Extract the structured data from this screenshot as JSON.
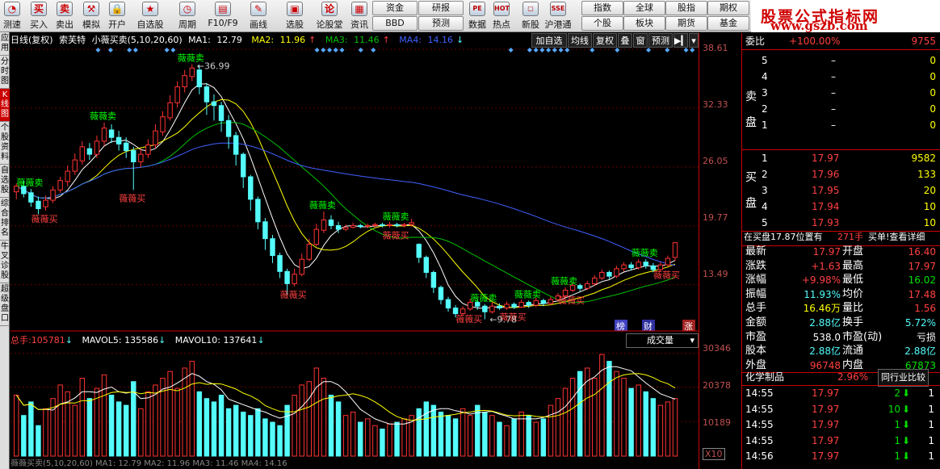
{
  "toolbar": {
    "buttons": [
      {
        "label": "测速",
        "icon": "speed-icon"
      },
      {
        "label": "买入",
        "icon": "buy-icon",
        "glyph": "买"
      },
      {
        "label": "卖出",
        "icon": "sell-icon",
        "glyph": "卖"
      },
      {
        "label": "模拟",
        "icon": "simulate-icon",
        "glyph": "⚒"
      },
      {
        "label": "开户",
        "icon": "open-account-icon",
        "glyph": "🔒"
      },
      {
        "label": "自选股",
        "icon": "watchlist-icon",
        "glyph": "★"
      },
      {
        "label": "周期",
        "icon": "period-icon",
        "glyph": "◷"
      },
      {
        "label": "F10/F9",
        "icon": "f10-icon",
        "glyph": "▤"
      },
      {
        "label": "画线",
        "icon": "draw-line-icon",
        "glyph": "✎"
      },
      {
        "label": "选股",
        "icon": "stock-select-icon",
        "glyph": "▣"
      },
      {
        "label": "论股堂",
        "icon": "forum-icon",
        "glyph": "论"
      },
      {
        "label": "资讯",
        "icon": "news-icon",
        "glyph": "▦"
      }
    ],
    "small_buttons": [
      "资金",
      "研报",
      "指数",
      "全球",
      "股指",
      "期权",
      "BBD",
      "预测",
      "个股",
      "板块",
      "期货",
      "基金"
    ],
    "right_icons": [
      {
        "label": "数据",
        "glyph": "PE"
      },
      {
        "label": "热点",
        "glyph": "HOT"
      },
      {
        "label": "新股",
        "glyph": "▢"
      },
      {
        "label": "沪港通",
        "glyph": "SSE"
      }
    ],
    "promo_title": "股票公式指标网",
    "promo_url": "www.gszb.com"
  },
  "left_tabs": [
    "应用",
    "分时图",
    "K线图",
    "个股资料",
    "自选股",
    "综合排名",
    "牛叉诊股",
    "超级盘口"
  ],
  "chart": {
    "period": "日线(复权)",
    "stock_name": "索芙特",
    "indicator": "小薇买卖(5,10,20,60)",
    "ma1_label": "MA1:",
    "ma1": "12.79",
    "ma2_label": "MA2:",
    "ma2": "11.96",
    "ma3_label": "MA3:",
    "ma3": "11.46",
    "ma4_label": "MA4:",
    "ma4": "14.16",
    "buttons": [
      "加自选",
      "均线",
      "复权",
      "叠",
      "窗",
      "预测"
    ],
    "y_labels": [
      "38.61",
      "32.33",
      "26.05",
      "19.77",
      "13.49"
    ],
    "high_marker": "36.99",
    "low_marker": "9.78",
    "bottom_badges": [
      "榜",
      "财",
      "涨"
    ],
    "signal_buy": "薇薇买",
    "signal_sell": "薇薇卖",
    "colors": {
      "up": "#ff3232",
      "down": "#54fcfc",
      "ma1": "#ffffff",
      "ma2": "#ffff00",
      "ma3": "#00c000",
      "ma4": "#4060ff",
      "sell_signal": "#00ff00",
      "buy_signal": "#ff4040"
    }
  },
  "volume": {
    "total_label": "总手:",
    "total": "105781",
    "mavol5_label": "MAVOL5:",
    "mavol5": "135586",
    "mavol10_label": "MAVOL10:",
    "mavol10": "137641",
    "dropdown": "成交量",
    "y_labels": [
      "30346",
      "20378",
      "10189"
    ],
    "unit": "X10",
    "bottom_text": "薇薇买卖(5,10,20,60) MA1: 12.79 MA2: 11.96 MA3: 11.46 MA4: 14.16"
  },
  "panel": {
    "weibi_label": "委比",
    "weibi": "+100.00%",
    "weicha": "9755",
    "sell_label_1": "卖",
    "sell_label_2": "盘",
    "buy_label_1": "买",
    "buy_label_2": "盘",
    "asks": [
      {
        "level": "5",
        "price": "–",
        "vol": "0"
      },
      {
        "level": "4",
        "price": "–",
        "vol": "0"
      },
      {
        "level": "3",
        "price": "–",
        "vol": "0"
      },
      {
        "level": "2",
        "price": "–",
        "vol": "0"
      },
      {
        "level": "1",
        "price": "–",
        "vol": "0"
      }
    ],
    "bids": [
      {
        "level": "1",
        "price": "17.97",
        "vol": "9582"
      },
      {
        "level": "2",
        "price": "17.96",
        "vol": "133"
      },
      {
        "level": "3",
        "price": "17.95",
        "vol": "20"
      },
      {
        "level": "4",
        "price": "17.94",
        "vol": "10"
      },
      {
        "level": "5",
        "price": "17.93",
        "vol": "10"
      }
    ],
    "buy_info": "在买盘17.87位置有",
    "buy_info_hands": "271手",
    "buy_info_link": "买单!查看详细",
    "quote": [
      {
        "l": "最新",
        "v": "17.97",
        "vc": "up",
        "l2": "开盘",
        "v2": "16.40",
        "vc2": "up"
      },
      {
        "l": "涨跌",
        "v": "+1.63",
        "vc": "up",
        "l2": "最高",
        "v2": "17.97",
        "vc2": "up"
      },
      {
        "l": "涨幅",
        "v": "+9.98%",
        "vc": "up",
        "l2": "最低",
        "v2": "16.02",
        "vc2": "down"
      },
      {
        "l": "振幅",
        "v": "11.93%",
        "vc": "cyan",
        "l2": "均价",
        "v2": "17.48",
        "vc2": "up"
      },
      {
        "l": "总手",
        "v": "16.46万",
        "vc": "yellow",
        "l2": "量比",
        "v2": "1.56",
        "vc2": "up"
      },
      {
        "l": "金额",
        "v": "2.88亿",
        "vc": "cyan",
        "l2": "换手",
        "v2": "5.72%",
        "vc2": "cyan"
      },
      {
        "l": "市盈",
        "v": "538.0",
        "vc": "white",
        "l2": "市盈(动)",
        "v2": "亏损",
        "vc2": "white"
      },
      {
        "l": "股本",
        "v": "2.88亿",
        "vc": "cyan",
        "l2": "流通",
        "v2": "2.88亿",
        "vc2": "cyan"
      },
      {
        "l": "外盘",
        "v": "96748",
        "vc": "up",
        "l2": "内盘",
        "v2": "67873",
        "vc2": "down"
      }
    ],
    "sector_name": "化学制品",
    "sector_change": "2.96%",
    "sector_btn": "同行业比较",
    "ticks": [
      {
        "time": "14:55",
        "price": "17.97",
        "vol": "2",
        "dir": "down"
      },
      {
        "time": "14:55",
        "price": "17.97",
        "vol": "10",
        "dir": "down"
      },
      {
        "time": "14:55",
        "price": "17.97",
        "vol": "1",
        "dir": "down"
      },
      {
        "time": "14:55",
        "price": "17.97",
        "vol": "1",
        "dir": "down"
      },
      {
        "time": "14:56",
        "price": "17.97",
        "vol": "1",
        "dir": "down"
      }
    ]
  },
  "chart_data": {
    "type": "candlestick",
    "title": "索芙特 日线(复权)",
    "ylim": [
      9.5,
      38.61
    ],
    "y_ticks": [
      38.61,
      32.33,
      26.05,
      19.77,
      13.49
    ],
    "candles": [
      [
        23.4,
        24.0,
        22.6,
        24.3
      ],
      [
        24.0,
        23.2,
        22.8,
        24.6
      ],
      [
        23.3,
        22.3,
        21.8,
        23.7
      ],
      [
        22.4,
        21.6,
        21.0,
        22.9
      ],
      [
        21.8,
        22.5,
        21.4,
        23.0
      ],
      [
        22.5,
        23.6,
        22.2,
        24.0
      ],
      [
        23.6,
        24.6,
        23.3,
        25.0
      ],
      [
        24.5,
        25.6,
        24.0,
        26.2
      ],
      [
        25.6,
        26.8,
        25.2,
        27.5
      ],
      [
        26.7,
        28.2,
        26.3,
        28.8
      ],
      [
        28.0,
        27.4,
        26.8,
        28.6
      ],
      [
        27.4,
        28.8,
        27.0,
        29.4
      ],
      [
        28.8,
        30.2,
        28.3,
        30.8
      ],
      [
        30.0,
        29.2,
        28.6,
        30.6
      ],
      [
        29.2,
        28.5,
        27.8,
        29.9
      ],
      [
        28.6,
        27.8,
        27.0,
        29.2
      ],
      [
        27.8,
        26.6,
        23.6,
        28.2
      ],
      [
        26.6,
        27.4,
        26.0,
        28.0
      ],
      [
        27.4,
        28.4,
        27.0,
        29.0
      ],
      [
        28.4,
        29.9,
        28.0,
        30.6
      ],
      [
        29.8,
        31.4,
        29.4,
        32.0
      ],
      [
        31.3,
        32.9,
        31.0,
        33.7
      ],
      [
        32.9,
        34.6,
        32.4,
        35.2
      ],
      [
        34.6,
        35.8,
        34.0,
        36.4
      ],
      [
        35.7,
        36.6,
        35.2,
        37.0
      ],
      [
        36.4,
        34.6,
        33.8,
        36.9
      ],
      [
        34.6,
        33.0,
        31.6,
        35.0
      ],
      [
        33.0,
        32.6,
        31.0,
        33.8
      ],
      [
        32.6,
        31.0,
        29.8,
        33.0
      ],
      [
        31.0,
        29.3,
        28.0,
        31.6
      ],
      [
        29.4,
        27.4,
        26.2,
        29.8
      ],
      [
        27.4,
        25.0,
        23.8,
        27.6
      ],
      [
        25.0,
        22.6,
        21.4,
        25.2
      ],
      [
        22.6,
        20.2,
        19.4,
        22.9
      ],
      [
        20.2,
        18.4,
        17.2,
        20.6
      ],
      [
        18.4,
        16.6,
        15.8,
        18.8
      ],
      [
        16.6,
        14.9,
        14.2,
        16.9
      ],
      [
        14.9,
        13.6,
        12.4,
        15.2
      ],
      [
        13.6,
        14.6,
        13.3,
        15.2
      ],
      [
        14.6,
        16.2,
        14.4,
        16.8
      ],
      [
        16.2,
        17.8,
        16.0,
        18.4
      ],
      [
        17.8,
        19.4,
        17.6,
        20.0
      ],
      [
        19.3,
        20.4,
        19.0,
        21.3
      ],
      [
        20.4,
        19.8,
        19.4,
        20.9
      ],
      [
        19.8,
        19.4,
        19.0,
        20.2
      ],
      [
        19.4,
        19.6,
        19.2,
        19.9
      ],
      [
        19.6,
        19.8,
        19.5,
        20.1
      ],
      [
        19.8,
        19.7,
        19.5,
        20.0
      ],
      [
        19.7,
        19.8,
        19.5,
        20.0
      ],
      [
        19.8,
        19.9,
        19.6,
        20.1
      ],
      [
        19.9,
        19.8,
        19.6,
        20.1
      ],
      [
        19.8,
        19.9,
        19.6,
        20.2
      ],
      [
        19.9,
        19.8,
        19.6,
        20.1
      ],
      [
        19.8,
        19.9,
        19.6,
        20.1
      ],
      [
        19.9,
        20.1,
        19.7,
        20.5
      ],
      [
        17.8,
        16.4,
        15.8,
        17.9
      ],
      [
        16.4,
        14.8,
        14.2,
        16.6
      ],
      [
        14.8,
        13.2,
        12.6,
        15.0
      ],
      [
        13.2,
        11.9,
        11.4,
        13.4
      ],
      [
        11.9,
        11.0,
        10.6,
        12.2
      ],
      [
        11.0,
        10.4,
        10.0,
        11.3
      ],
      [
        10.4,
        10.9,
        10.2,
        11.2
      ],
      [
        10.9,
        11.6,
        10.7,
        12.0
      ],
      [
        11.6,
        11.2,
        10.8,
        11.9
      ],
      [
        11.2,
        10.6,
        9.8,
        11.4
      ],
      [
        10.6,
        11.2,
        10.4,
        11.6
      ],
      [
        11.2,
        11.0,
        10.8,
        11.5
      ],
      [
        11.0,
        11.4,
        10.8,
        11.7
      ],
      [
        11.4,
        11.1,
        10.9,
        11.6
      ],
      [
        11.1,
        11.6,
        11.0,
        11.9
      ],
      [
        11.6,
        11.3,
        11.0,
        11.8
      ],
      [
        11.3,
        11.8,
        11.1,
        12.1
      ],
      [
        11.8,
        11.5,
        11.2,
        12.0
      ],
      [
        11.5,
        11.9,
        11.3,
        12.2
      ],
      [
        11.9,
        12.3,
        11.7,
        12.6
      ],
      [
        12.3,
        12.9,
        12.1,
        13.2
      ],
      [
        12.9,
        13.4,
        12.7,
        13.7
      ],
      [
        13.4,
        13.1,
        12.8,
        13.6
      ],
      [
        13.1,
        13.6,
        12.9,
        13.9
      ],
      [
        13.6,
        14.2,
        13.4,
        14.5
      ],
      [
        14.2,
        14.8,
        14.0,
        15.1
      ],
      [
        14.8,
        14.4,
        14.1,
        15.0
      ],
      [
        14.4,
        15.2,
        14.2,
        15.5
      ],
      [
        15.2,
        15.6,
        14.9,
        15.9
      ],
      [
        15.6,
        15.3,
        15.0,
        15.9
      ],
      [
        15.3,
        15.9,
        15.1,
        16.2
      ],
      [
        15.9,
        15.5,
        15.2,
        16.2
      ],
      [
        15.5,
        15.1,
        14.8,
        15.8
      ],
      [
        15.1,
        15.6,
        14.9,
        15.9
      ],
      [
        15.6,
        16.3,
        15.4,
        16.6
      ],
      [
        16.4,
        17.97,
        16.02,
        17.97
      ]
    ],
    "volumes": [
      180,
      120,
      160,
      90,
      140,
      170,
      210,
      190,
      150,
      230,
      170,
      200,
      240,
      180,
      160,
      150,
      220,
      140,
      190,
      210,
      230,
      250,
      200,
      260,
      280,
      190,
      170,
      160,
      180,
      140,
      150,
      130,
      120,
      140,
      110,
      100,
      90,
      150,
      180,
      210,
      220,
      260,
      230,
      180,
      160,
      120,
      130,
      100,
      110,
      90,
      80,
      95,
      100,
      110,
      120,
      140,
      160,
      150,
      130,
      120,
      110,
      140,
      120,
      150,
      130,
      120,
      100,
      90,
      110,
      130,
      120,
      100,
      110,
      150,
      170,
      200,
      230,
      250,
      260,
      230,
      300,
      280,
      250,
      230,
      200,
      210,
      190,
      170,
      150,
      160,
      170
    ],
    "signals": [
      {
        "index": 2,
        "type": "sell",
        "text": "薇薇卖"
      },
      {
        "index": 4,
        "type": "buy",
        "text": "薇薇买"
      },
      {
        "index": 12,
        "type": "sell",
        "text": "薇薇卖"
      },
      {
        "index": 16,
        "type": "buy",
        "text": "薇薇买"
      },
      {
        "index": 24,
        "type": "sell",
        "text": "薇薇卖"
      },
      {
        "index": 38,
        "type": "buy",
        "text": "薇薇买"
      },
      {
        "index": 42,
        "type": "sell",
        "text": "薇薇卖"
      },
      {
        "index": 52,
        "type": "sell",
        "text": "薇薇卖"
      },
      {
        "index": 52,
        "type": "buy",
        "text": "薇薇买"
      },
      {
        "index": 62,
        "type": "buy",
        "text": "薇薇买"
      },
      {
        "index": 64,
        "type": "sell",
        "text": "薇薇卖"
      },
      {
        "index": 68,
        "type": "buy",
        "text": "薇薇买"
      },
      {
        "index": 70,
        "type": "sell",
        "text": "薇薇卖"
      },
      {
        "index": 75,
        "type": "sell",
        "text": "薇薇卖"
      },
      {
        "index": 76,
        "type": "buy",
        "text": "薇薇买"
      },
      {
        "index": 86,
        "type": "sell",
        "text": "薇薇卖"
      },
      {
        "index": 89,
        "type": "buy",
        "text": "薇薇买"
      }
    ]
  }
}
